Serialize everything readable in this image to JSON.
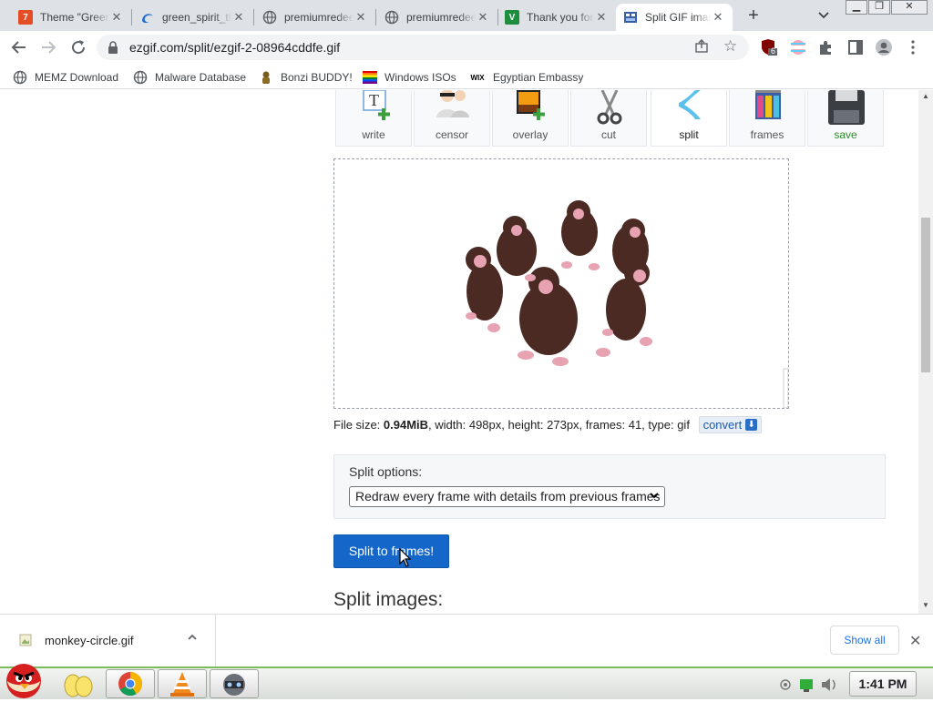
{
  "browser": {
    "tabs": [
      {
        "title": "Theme \"Green Spirit\"",
        "icon": "theme-icon"
      },
      {
        "title": "green_spirit_theme",
        "icon": "edge-icon"
      },
      {
        "title": "premiumredeem",
        "icon": "globe-icon"
      },
      {
        "title": "premiumredeem",
        "icon": "globe-icon"
      },
      {
        "title": "Thank you for",
        "icon": "green-v-icon"
      },
      {
        "title": "Split GIF image",
        "icon": "ezgif-icon",
        "active": true
      }
    ],
    "new_tab": "+",
    "url": "ezgif.com/split/ezgif-2-08964cddfe.gif",
    "extension_badge": "6",
    "bookmarks": [
      {
        "label": "MEMZ Download",
        "icon": "globe-icon"
      },
      {
        "label": "Malware Database",
        "icon": "globe-icon"
      },
      {
        "label": "Bonzi BUDDY!",
        "icon": "bonzi-icon"
      },
      {
        "label": "Windows ISOs",
        "icon": "rainbow-flag-icon"
      },
      {
        "label": "Egyptian Embassy",
        "icon": "wix-icon"
      }
    ]
  },
  "page": {
    "tools": [
      {
        "label": "write",
        "icon": "write-icon"
      },
      {
        "label": "censor",
        "icon": "censor-icon"
      },
      {
        "label": "overlay",
        "icon": "overlay-icon"
      },
      {
        "label": "cut",
        "icon": "scissors-icon"
      },
      {
        "label": "split",
        "icon": "split-icon",
        "active": true
      },
      {
        "label": "frames",
        "icon": "frames-icon"
      },
      {
        "label": "save",
        "icon": "save-icon"
      }
    ],
    "fileinfo": {
      "size_label": "File size: ",
      "size": "0.94MiB",
      "rest": ", width: 498px, height: 273px, frames: 41, type: gif",
      "convert": "convert"
    },
    "options": {
      "label": "Split options:",
      "selected": "Redraw every frame with details from previous frames"
    },
    "split_button": "Split to frames!",
    "split_heading": "Split images:"
  },
  "downloads": {
    "file": "monkey-circle.gif",
    "show_all": "Show all"
  },
  "taskbar": {
    "clock": "1:41 PM"
  }
}
